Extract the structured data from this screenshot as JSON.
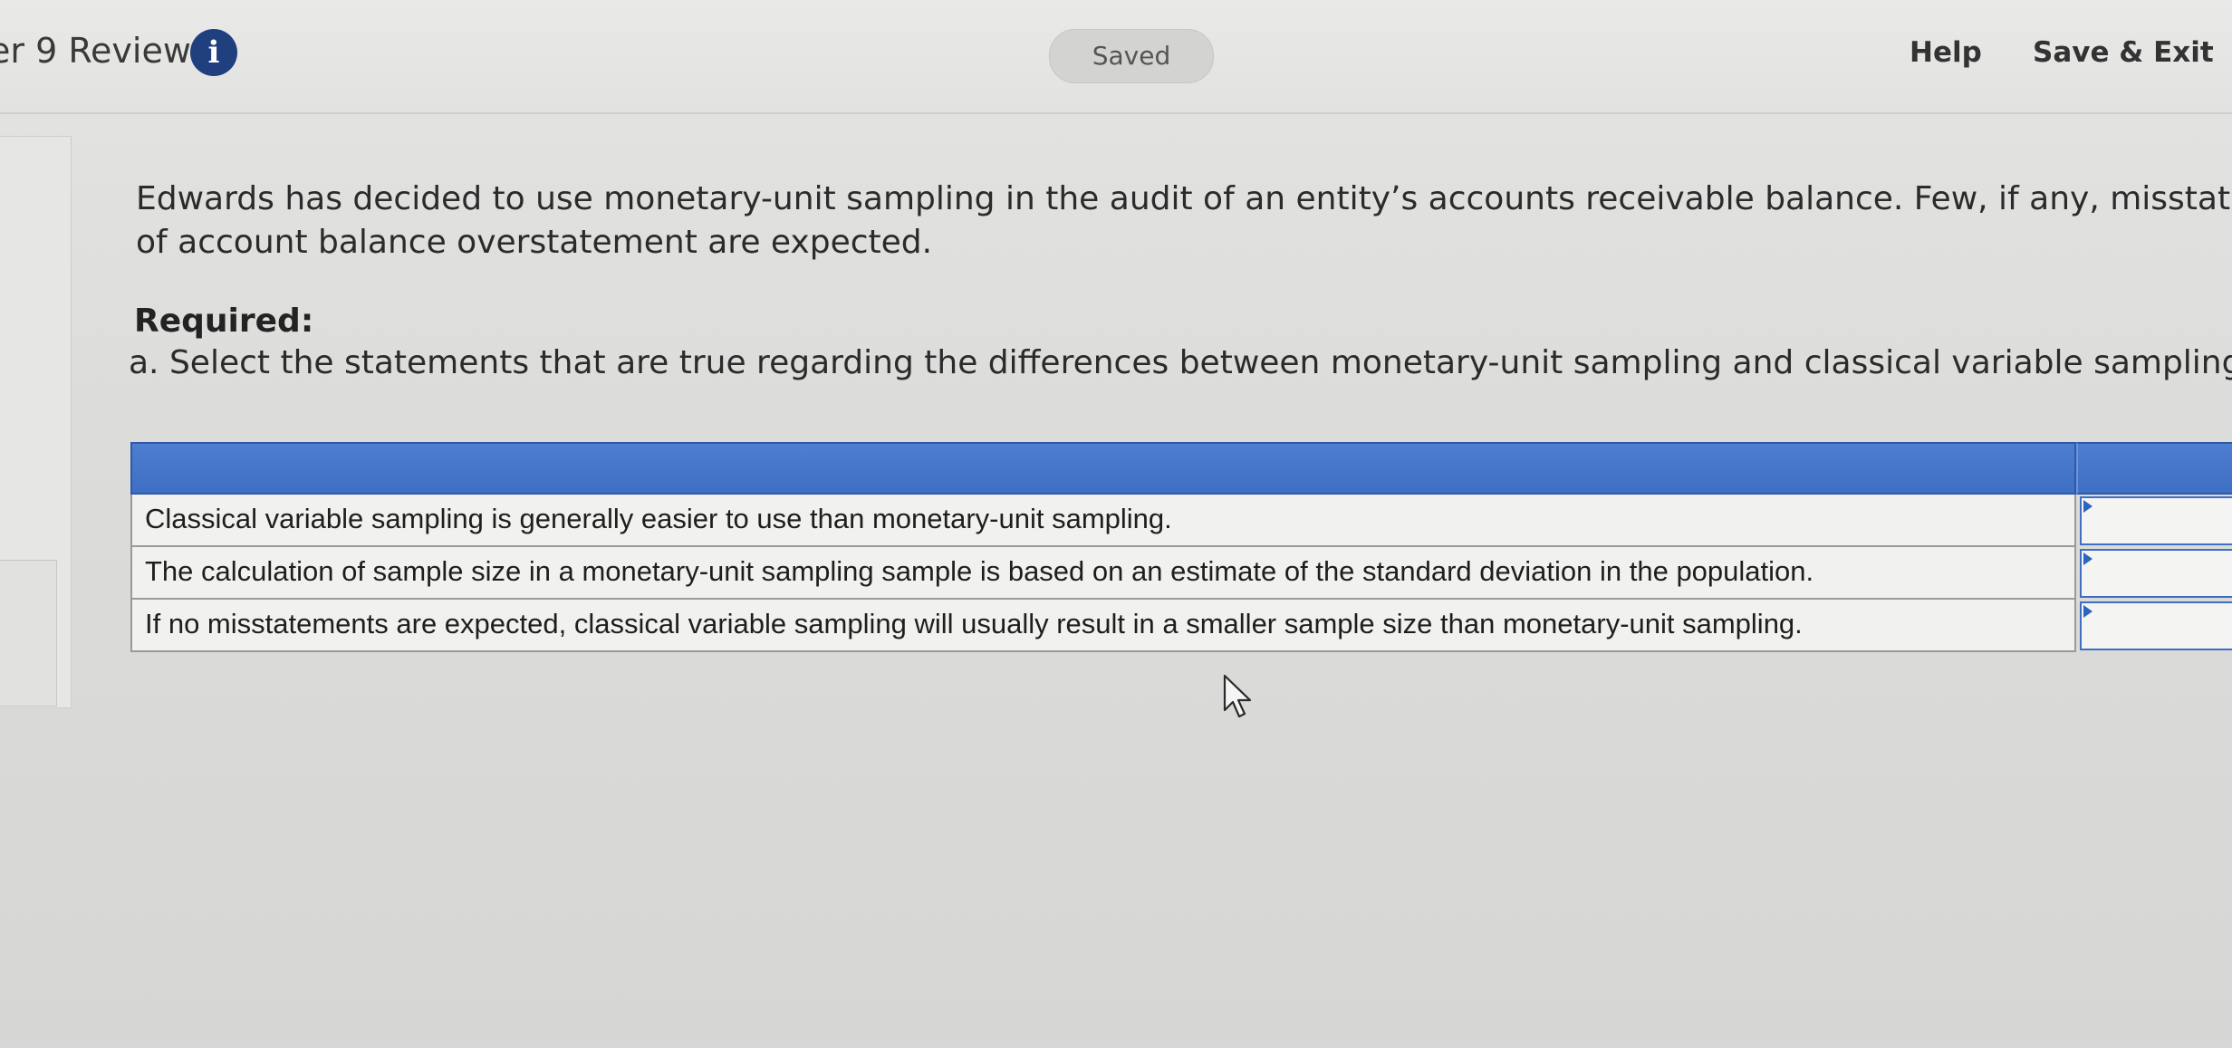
{
  "header": {
    "title": "er 9 Review",
    "info_icon": "info-icon",
    "status": "Saved",
    "help_label": "Help",
    "save_exit_label": "Save & Exit"
  },
  "question": {
    "line1": "Edwards has decided to use monetary-unit sampling in the audit of an entity’s accounts receivable balance. Few, if any, misstatem",
    "line2": "of account balance overstatement are expected.",
    "required_heading": "Required:",
    "required_a": "a. Select the statements that are true regarding the differences between monetary-unit sampling and classical variable sampling."
  },
  "table": {
    "rows": [
      {
        "statement": "Classical variable sampling is generally easier to use than monetary-unit sampling.",
        "selected": ""
      },
      {
        "statement": "The calculation of sample size in a monetary-unit sampling sample is based on an estimate of the standard deviation in the population.",
        "selected": ""
      },
      {
        "statement": "If no misstatements are expected, classical variable sampling will usually result in a smaller sample size than monetary-unit sampling.",
        "selected": ""
      }
    ]
  },
  "colors": {
    "table_header": "#4a7acc",
    "info_icon_bg": "#1f3f7e",
    "dropdown_arrow": "#2e63c0"
  }
}
